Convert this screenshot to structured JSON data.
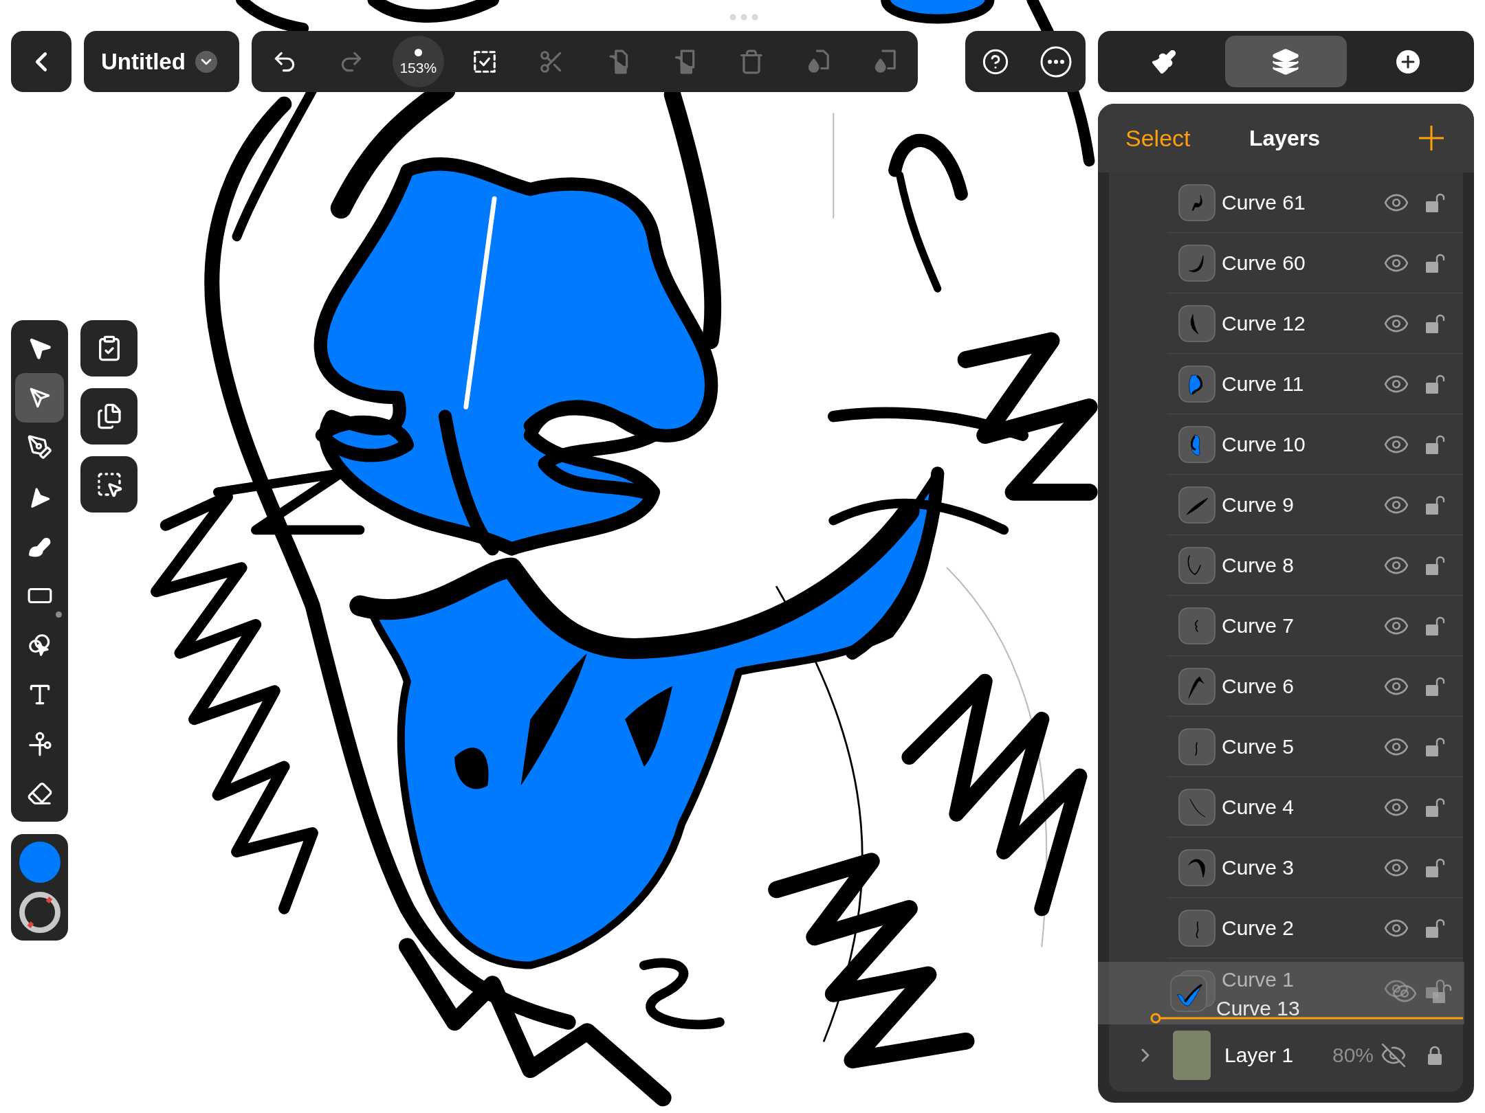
{
  "document": {
    "title": "Untitled"
  },
  "toolbar": [
    {
      "kind": "undo",
      "disabled": false
    },
    {
      "kind": "redo",
      "disabled": true
    },
    {
      "kind": "zoom",
      "reading": "153%"
    },
    {
      "kind": "select_all",
      "disabled": false
    },
    {
      "kind": "cut",
      "disabled": true
    },
    {
      "kind": "copy",
      "disabled": true
    },
    {
      "kind": "paste",
      "disabled": true
    },
    {
      "kind": "delete",
      "disabled": true
    },
    {
      "kind": "copy_style",
      "disabled": true
    },
    {
      "kind": "paste_style",
      "disabled": true
    }
  ],
  "inspector_tabs": [
    {
      "kind": "style",
      "selected": false
    },
    {
      "kind": "layers",
      "selected": true
    },
    {
      "kind": "add",
      "selected": false
    }
  ],
  "tools": [
    {
      "kind": "select",
      "selected": false,
      "submenu": false
    },
    {
      "kind": "node",
      "selected": true,
      "submenu": false
    },
    {
      "kind": "pen",
      "selected": false,
      "submenu": false
    },
    {
      "kind": "pencil",
      "selected": false,
      "submenu": false
    },
    {
      "kind": "brush",
      "selected": false,
      "submenu": false
    },
    {
      "kind": "rectangle",
      "selected": false,
      "submenu": true
    },
    {
      "kind": "shape_builder",
      "selected": false,
      "submenu": false
    },
    {
      "kind": "text",
      "selected": false,
      "submenu": false
    },
    {
      "kind": "scissors",
      "selected": false,
      "submenu": false
    },
    {
      "kind": "eraser",
      "selected": false,
      "submenu": false
    }
  ],
  "swatches": [
    {
      "kind": "fill",
      "color": "#007aff"
    },
    {
      "kind": "no_stroke"
    }
  ],
  "quick_actions": [
    {
      "kind": "paste"
    },
    {
      "kind": "duplicate"
    },
    {
      "kind": "select_same"
    }
  ],
  "layers_panel": {
    "select_label": "Select",
    "title": "Layers",
    "items": [
      {
        "name": "Curve 61",
        "visible": true,
        "locked": false
      },
      {
        "name": "Curve 60",
        "visible": true,
        "locked": false
      },
      {
        "name": "Curve 12",
        "visible": true,
        "locked": false
      },
      {
        "name": "Curve 11",
        "visible": true,
        "locked": false
      },
      {
        "name": "Curve 10",
        "visible": true,
        "locked": false
      },
      {
        "name": "Curve 9",
        "visible": true,
        "locked": false
      },
      {
        "name": "Curve 8",
        "visible": true,
        "locked": false
      },
      {
        "name": "Curve 7",
        "visible": true,
        "locked": false
      },
      {
        "name": "Curve 6",
        "visible": true,
        "locked": false
      },
      {
        "name": "Curve 5",
        "visible": true,
        "locked": false
      },
      {
        "name": "Curve 4",
        "visible": true,
        "locked": false
      },
      {
        "name": "Curve 3",
        "visible": true,
        "locked": false
      },
      {
        "name": "Curve 2",
        "visible": true,
        "locked": false
      },
      {
        "name": "Curve 1",
        "visible": true,
        "locked": false
      }
    ],
    "layer": {
      "name": "Layer 1",
      "opacity": "80%",
      "expanded": false,
      "visible": false,
      "locked": true
    },
    "dragged_item": {
      "name": "Curve 13",
      "visible": true,
      "locked": false
    }
  }
}
